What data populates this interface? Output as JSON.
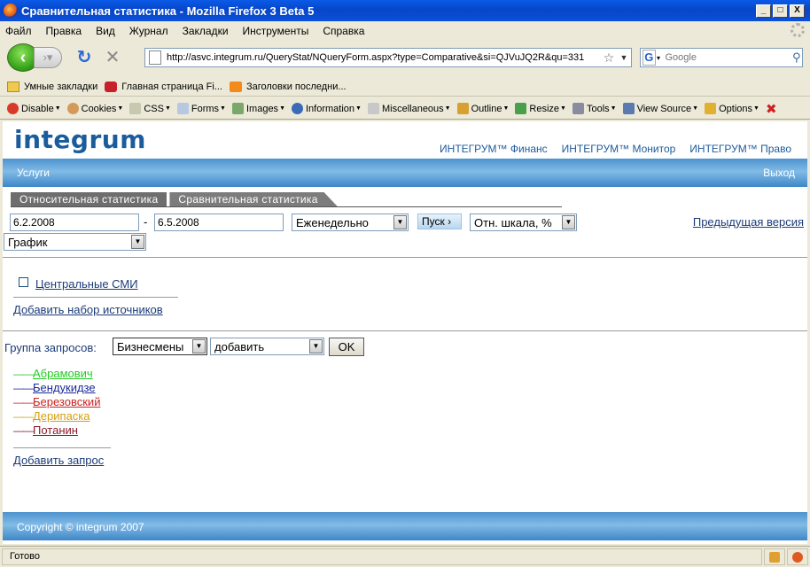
{
  "window": {
    "title": "Сравнительная статистика - Mozilla Firefox 3 Beta 5",
    "min": "_",
    "max": "□",
    "close": "X"
  },
  "menu": [
    "Файл",
    "Правка",
    "Вид",
    "Журнал",
    "Закладки",
    "Инструменты",
    "Справка"
  ],
  "nav": {
    "url": "http://asvc.integrum.ru/QueryStat/NQueryForm.aspx?type=Comparative&si=QJVuJQ2R&qu=331",
    "search_placeholder": "Google"
  },
  "bookmarks": [
    "Умные закладки",
    "Главная страница Fi...",
    "Заголовки последни..."
  ],
  "devbar": [
    "Disable",
    "Cookies",
    "CSS",
    "Forms",
    "Images",
    "Information",
    "Miscellaneous",
    "Outline",
    "Resize",
    "Tools",
    "View Source",
    "Options"
  ],
  "site": {
    "logo": "integrum",
    "products": [
      "ИНТЕГРУМ™ Финанс",
      "ИНТЕГРУМ™ Монитор",
      "ИНТЕГРУМ™ Право"
    ],
    "nav_left": "Услуги",
    "nav_right": "Выход",
    "tabs": [
      "Относительная статистика",
      "Сравнительная статистика"
    ],
    "date_from": "6.2.2008",
    "date_dash": "-",
    "date_to": "6.5.2008",
    "period": "Еженедельно",
    "run": "Пуск",
    "scale": "Отн. шкала, %",
    "prev_version": "Предыдущая версия",
    "view": "График",
    "source": "Центральные СМИ",
    "add_sources": "Добавить набор источников",
    "group_label": "Группа запросов:",
    "group_value": "Бизнесмены",
    "add_value": "добавить",
    "ok": "OK",
    "queries": [
      {
        "dash": "——",
        "name": "Абрамович",
        "color": "#22cc22"
      },
      {
        "dash": "——",
        "name": "Бендукидзе",
        "color": "#1a2a9a"
      },
      {
        "dash": "——",
        "name": "Березовский",
        "color": "#cc2222"
      },
      {
        "dash": "——",
        "name": "Дерипаска",
        "color": "#d4a010"
      },
      {
        "dash": "——",
        "name": "Потанин",
        "color": "#8a1a2a"
      }
    ],
    "add_query": "Добавить запрос",
    "copyright": "Copyright © integrum 2007"
  },
  "status": "Готово"
}
